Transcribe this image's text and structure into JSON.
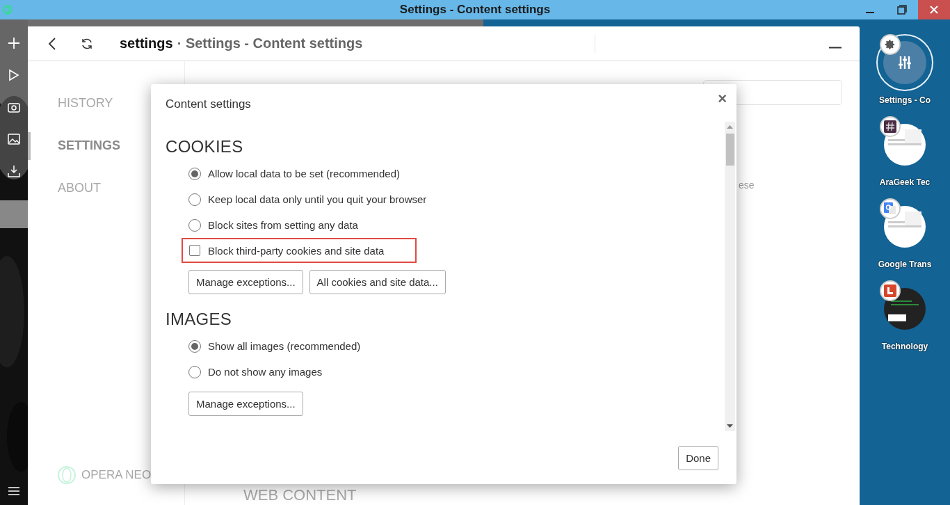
{
  "window": {
    "title": "Settings - Content settings"
  },
  "header": {
    "page": "settings",
    "title": "· Settings - Content settings"
  },
  "nav": {
    "items": [
      {
        "label": "HISTORY",
        "selected": false
      },
      {
        "label": "SETTINGS",
        "selected": true
      },
      {
        "label": "ABOUT",
        "selected": false
      }
    ],
    "brand": "OPERA NEO"
  },
  "page_behind": {
    "fragment": "ese",
    "section_heading": "WEB CONTENT"
  },
  "dialog": {
    "title": "Content settings",
    "close": "×",
    "sections": [
      {
        "heading": "COOKIES",
        "options": [
          {
            "kind": "radio",
            "label": "Allow local data to be set (recommended)",
            "selected": true
          },
          {
            "kind": "radio",
            "label": "Keep local data only until you quit your browser",
            "selected": false
          },
          {
            "kind": "radio",
            "label": "Block sites from setting any data",
            "selected": false
          },
          {
            "kind": "checkbox",
            "label": "Block third-party cookies and site data",
            "checked": false,
            "highlighted": true
          }
        ],
        "buttons": [
          "Manage exceptions...",
          "All cookies and site data..."
        ]
      },
      {
        "heading": "IMAGES",
        "options": [
          {
            "kind": "radio",
            "label": "Show all images (recommended)",
            "selected": true
          },
          {
            "kind": "radio",
            "label": "Do not show any images",
            "selected": false
          }
        ],
        "buttons": [
          "Manage exceptions..."
        ]
      }
    ],
    "done": "Done"
  },
  "tabs": [
    {
      "label": "Settings - Co",
      "selected": true,
      "kind": "settings"
    },
    {
      "label": "AraGeek Tec",
      "selected": false,
      "kind": "chat"
    },
    {
      "label": "Google Trans",
      "selected": false,
      "kind": "translate"
    },
    {
      "label": "Technology",
      "selected": false,
      "kind": "tile"
    }
  ]
}
